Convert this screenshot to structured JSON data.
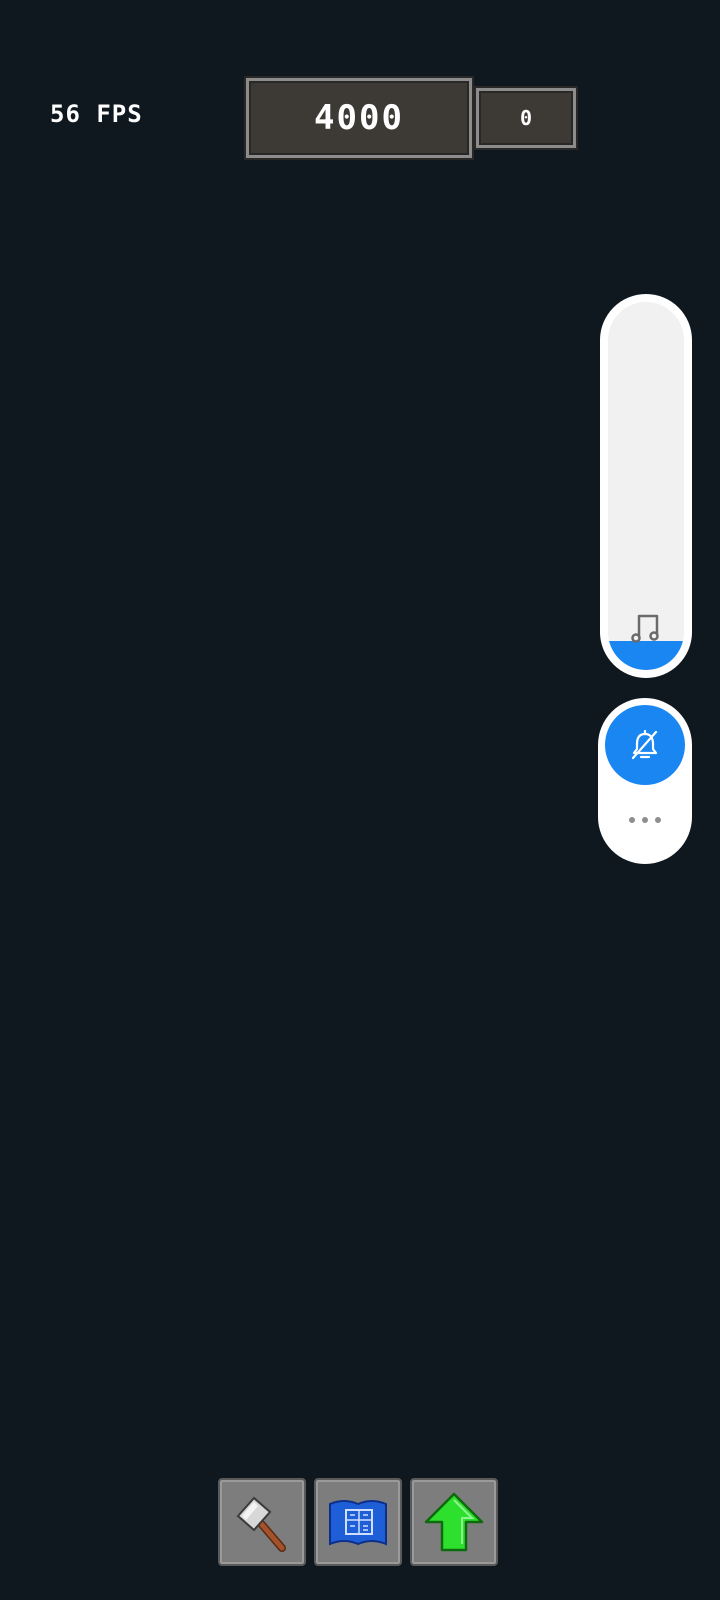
{
  "hud": {
    "fps_label": "56 FPS",
    "score": "4000",
    "counter": "0"
  },
  "volume_overlay": {
    "level_fraction": 0.08,
    "icon": "music-note-icon",
    "ringer_icon": "bell-muted-icon",
    "more_icon": "more-dots-icon",
    "accent_color": "#1a86f2"
  },
  "toolbar": {
    "tools": [
      {
        "icon": "hammer-icon"
      },
      {
        "icon": "blueprint-icon"
      },
      {
        "icon": "upgrade-arrow-icon"
      }
    ]
  },
  "colors": {
    "background": "#0f181f",
    "panel": "#3d3a36",
    "panel_border": "#8c8c8c",
    "tool_background": "#7d7d7d"
  }
}
